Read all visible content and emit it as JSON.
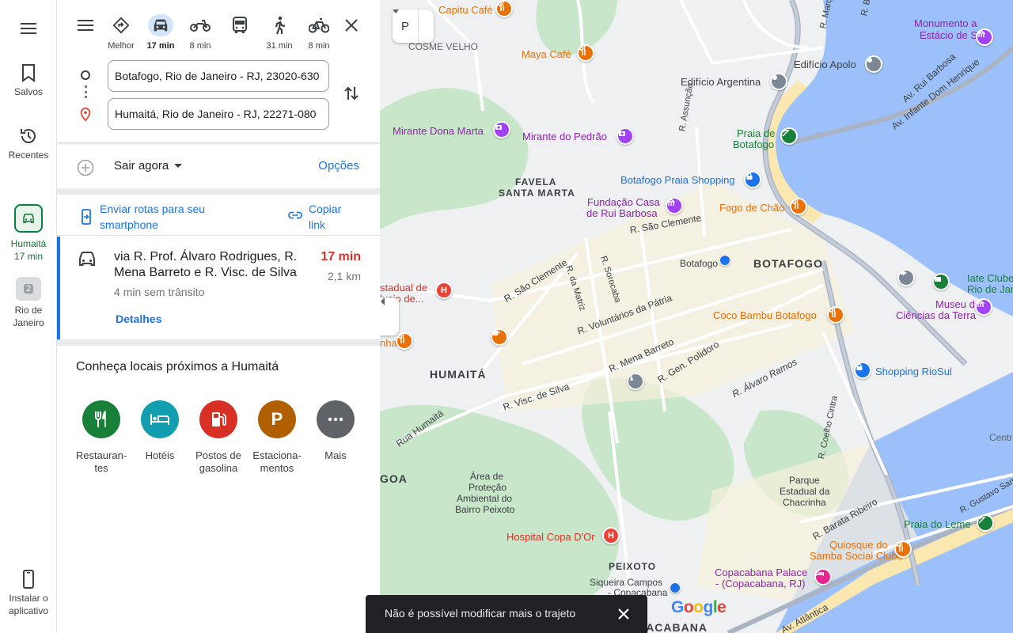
{
  "rail": {
    "saved": "Salvos",
    "recents": "Recentes",
    "recent_route": {
      "place": "Humaitá",
      "time": "17 min"
    },
    "recent_place": {
      "name_line1": "Rio de",
      "name_line2": "Janeiro",
      "badge": "2"
    },
    "install_line1": "Instalar o",
    "install_line2": "aplicativo"
  },
  "modes": [
    {
      "icon": "diamond-directions-icon",
      "label": "Melhor"
    },
    {
      "icon": "car-icon",
      "label": "17 min",
      "active": true
    },
    {
      "icon": "motorcycle-icon",
      "label": "8 min"
    },
    {
      "icon": "bus-icon",
      "label": ""
    },
    {
      "icon": "walk-icon",
      "label": "31 min"
    },
    {
      "icon": "bicycle-icon",
      "label": "8 min"
    }
  ],
  "inputs": {
    "origin": "Botafogo, Rio de Janeiro - RJ, 23020-630",
    "destination": "Humaitá, Rio de Janeiro - RJ, 22271-080"
  },
  "leave": {
    "label": "Sair agora",
    "options": "Opções"
  },
  "share": {
    "send_line1": "Enviar rotas para seu",
    "send_line2": "smartphone",
    "copy_line1": "Copiar",
    "copy_line2": "link"
  },
  "route": {
    "via_line1": "via R. Prof. Álvaro Rodrigues, R.",
    "via_line2": "Mena Barreto e R. Visc. de Silva",
    "time": "17 min",
    "distance": "2,1 km",
    "traffic": "4 min sem trânsito",
    "details": "Detalhes"
  },
  "nearby": {
    "title": "Conheça locais próximos a Humaitá",
    "categories": [
      {
        "line1": "Restauran-",
        "line2": "tes",
        "color": "#188038",
        "icon": "fork-knife-icon"
      },
      {
        "line1": "Hotéis",
        "line2": "",
        "color": "#129eaf",
        "icon": "bed-icon"
      },
      {
        "line1": "Postos de",
        "line2": "gasolina",
        "color": "#d93025",
        "icon": "gas-pump-icon"
      },
      {
        "line1": "Estaciona-",
        "line2": "mentos",
        "color": "#b06000",
        "icon": "parking-icon"
      },
      {
        "line1": "Mais",
        "line2": "",
        "color": "#5f6368",
        "icon": "more-dots-icon"
      }
    ]
  },
  "map": {
    "layer_symbol": "P",
    "labels": {
      "capitu": "Capitu Café",
      "cosme_velho": "COSME VELHO",
      "maya": "Maya Café",
      "monumento1": "Monumento a",
      "monumento2": "Estácio de Sá",
      "edificio_apolo": "Edifício Apolo",
      "edificio_argentina": "Edifício Argentina",
      "mirante_dona_marta": "Mirante Dona Marta",
      "mirante_pedrao": "Mirante do Pedrão",
      "praia_botafogo1": "Praia de",
      "praia_botafogo2": "Botafogo",
      "favela1": "FAVELA",
      "favela2": "SANTA MARTA",
      "botafogo_praia_shopping": "Botafogo Praia Shopping",
      "fundacao1": "Fundação Casa",
      "fundacao2": "de Rui Barbosa",
      "fogo_de_chao": "Fogo de Chão",
      "botafogo_station": "Botafogo",
      "botafogo_area": "BOTAFOGO",
      "iate1": "Iate Clube do",
      "iate2": "Rio de Janeiro",
      "museu1": "Museu de",
      "museu2": "Ciências da Terra",
      "coco_bambu": "Coco Bambu Botafogo",
      "hospital_estadual1": "stadual de",
      "hospital_estadual2": "lusio de...",
      "nha": "nha",
      "humaita_area": "HUMAITÁ",
      "shopping_riosul": "Shopping RioSul",
      "centro": "Centro",
      "area_protecao1": "Área de",
      "area_protecao2": "Proteção",
      "area_protecao3": "Ambiental do",
      "area_protecao4": "Bairro Peixoto",
      "parque1": "Parque",
      "parque2": "Estadual da",
      "parque3": "Chacrinha",
      "goa": "GOA",
      "hospital_copa": "Hospital Copa D'Or",
      "praia_leme": "Praia do Leme",
      "quiosque1": "Quiosque do",
      "quiosque2": "Samba Social Clube",
      "peixoto": "PEIXOTO",
      "copacabana_palace1": "Copacabana Palace",
      "copacabana_palace2": "- (Copacabana, RJ)",
      "siqueira1": "Siqueira Campos",
      "siqueira2": "- Copacabana",
      "copacabana_area": "OPACABANA"
    },
    "streets": {
      "sao_clemente_top": "R. São Clemente",
      "sao_clemente_left": "R. São Clemente",
      "voluntarios": "R. Voluntários da Pátria",
      "mena_barreto": "R. Mena Barreto",
      "visc_silva": "R. Visc. de Silva",
      "gen_polidoro": "R. Gen. Polidoro",
      "alvaro_ramos": "R. Álvaro Ramos",
      "rua_humaita": "Rua Humaitá",
      "da_matriz": "R. da Matriz",
      "sorocaba": "R. Sorocaba",
      "assuncao": "R. Assunção",
      "rui_barbosa": "Av. Rui Barbosa",
      "infante": "Av. Infante Dom Henrique",
      "coelho_cintra": "R. Coelho Cintra",
      "barata_ribeiro": "R. Barata Ribeiro",
      "gustavo_sampaio": "R. Gustavo Sam",
      "atlantica": "Av. Atlântica",
      "marq": "R. Marq",
      "r_b": "R. B"
    },
    "google": [
      "G",
      "o",
      "o",
      "g",
      "l",
      "e"
    ],
    "google_colors": [
      "#4285f4",
      "#ea4335",
      "#fbbc05",
      "#4285f4",
      "#34a853",
      "#ea4335"
    ]
  },
  "snackbar": {
    "message": "Não é possível modificar mais o trajeto"
  }
}
